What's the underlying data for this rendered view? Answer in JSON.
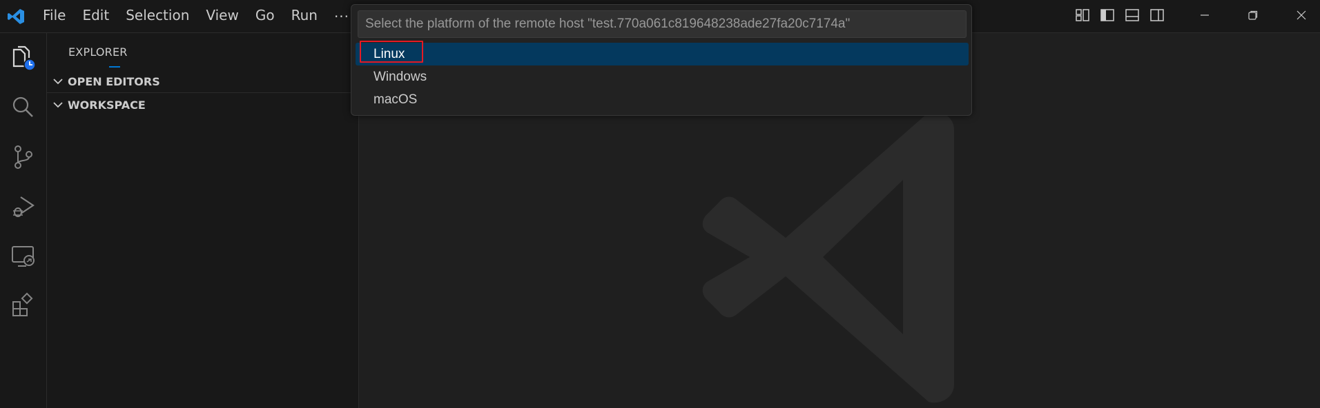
{
  "titlebar": {
    "menu": [
      "File",
      "Edit",
      "Selection",
      "View",
      "Go",
      "Run"
    ],
    "more": "···",
    "layout_buttons": [
      "customize-layout-icon",
      "toggle-primary-sidebar-icon",
      "toggle-panel-icon",
      "toggle-secondary-sidebar-icon"
    ],
    "window_controls": [
      "minimize-icon",
      "restore-icon",
      "close-icon"
    ]
  },
  "activitybar": {
    "items": [
      "explorer-icon",
      "search-icon",
      "source-control-icon",
      "run-debug-icon",
      "remote-explorer-icon",
      "extensions-icon"
    ]
  },
  "sidebar": {
    "title": "EXPLORER",
    "sections": [
      {
        "label": "OPEN EDITORS"
      },
      {
        "label": "WORKSPACE"
      }
    ]
  },
  "quickpick": {
    "placeholder": "Select the platform of the remote host \"test.770a061c819648238ade27fa20c7174a\"",
    "items": [
      "Linux",
      "Windows",
      "macOS"
    ],
    "selected_index": 0
  },
  "colors": {
    "accent": "#0078d4",
    "selection": "#04395e",
    "highlight_box": "#e51a24"
  }
}
